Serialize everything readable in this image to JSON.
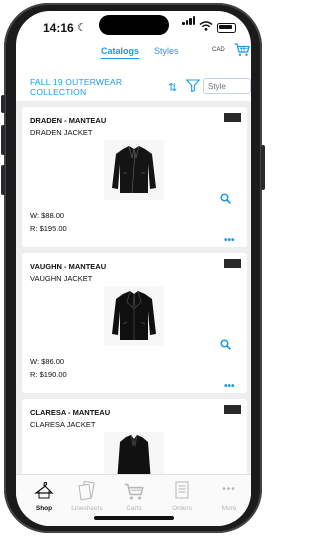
{
  "status": {
    "time": "14:16"
  },
  "header": {
    "tabs": [
      {
        "label": "Catalogs",
        "active": true
      },
      {
        "label": "Styles",
        "active": false
      }
    ],
    "currency": "CAD"
  },
  "collection": {
    "title": "FALL 19 OUTERWEAR COLLECTION"
  },
  "search": {
    "placeholder": "Style"
  },
  "products": [
    {
      "name": "DRADEN - MANTEAU",
      "subtitle": "DRADEN JACKET",
      "wholesale": "W: $88.00",
      "retail": "R: $195.00"
    },
    {
      "name": "VAUGHN - MANTEAU",
      "subtitle": "VAUGHN JACKET",
      "wholesale": "W: $86.00",
      "retail": "R: $190.00"
    },
    {
      "name": "CLARESA - MANTEAU",
      "subtitle": "CLARESA JACKET"
    }
  ],
  "bottom_nav": [
    {
      "label": "Shop",
      "icon": "hanger-icon",
      "active": true
    },
    {
      "label": "Linesheets",
      "icon": "documents-icon",
      "active": false
    },
    {
      "label": "Carts",
      "icon": "cart-icon",
      "active": false
    },
    {
      "label": "Orders",
      "icon": "order-list-icon",
      "active": false
    },
    {
      "label": "More",
      "icon": "more-dots-icon",
      "active": false
    }
  ],
  "colors": {
    "accent": "#1a9be6",
    "swatch": "#2a2a2a",
    "inactive": "#b5b5b5"
  }
}
